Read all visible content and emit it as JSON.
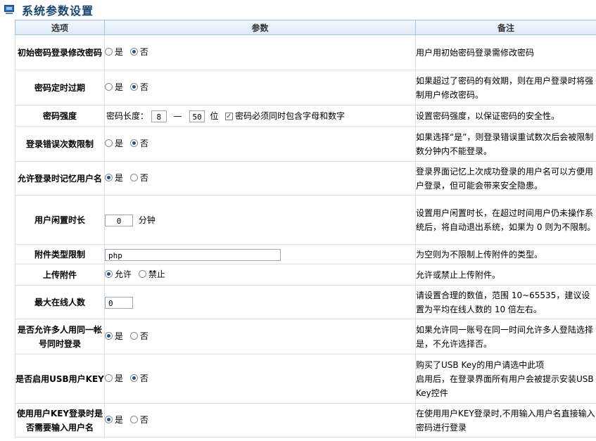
{
  "page": {
    "title": "系统参数设置",
    "icon": "monitor-icon"
  },
  "columns": {
    "option": "选项",
    "param": "参数",
    "note": "备注"
  },
  "rows": [
    {
      "label": "初始密码登录修改密码",
      "opt1": "是",
      "opt2": "否",
      "selected": 2,
      "note": "用户用初始密码登录需修改密码"
    },
    {
      "label": "密码定时过期",
      "opt1": "是",
      "opt2": "否",
      "selected": 2,
      "note": "如果超过了密码的有效期，则在用户登录时将强制用户修改密码。"
    },
    {
      "label": "密码强度",
      "prefix": "密码长度：",
      "min": "8",
      "dash": "—",
      "max": "50",
      "unit": "位",
      "checkbox": "密码必须同时包含字母和数字",
      "checked": true,
      "note": "设置密码强度，以保证密码的安全性。"
    },
    {
      "label": "登录错误次数限制",
      "opt1": "是",
      "opt2": "否",
      "selected": 2,
      "note": "如果选择“是”，则登录错误重试数次后会被限制数分钟内不能登录。"
    },
    {
      "label": "允许登录时记忆用户名",
      "opt1": "是",
      "opt2": "否",
      "selected": 1,
      "note": "登录界面记忆上次成功登录的用户名可以方便用户登录，但可能会带来安全隐患。"
    },
    {
      "label": "用户闲置时长",
      "value": "0",
      "unit": "分钟",
      "note": "设置用户闲置时长，在超过时间用户仍未操作系统后，将自动退出系统，如果为 0 则为不限制。"
    },
    {
      "label": "附件类型限制",
      "value": "php",
      "note": "为空则为不限制上传附件的类型。"
    },
    {
      "label": "上传附件",
      "opt1": "允许",
      "opt2": "禁止",
      "selected": 1,
      "note": "允许或禁止上传附件。"
    },
    {
      "label": "最大在线人数",
      "value": "0",
      "note": "请设置合理的数值，范围 10~65535，建议设置为平均在线人数的 10 倍左右。"
    },
    {
      "label": "是否允许多人用同一帐号同时登录",
      "opt1": "是",
      "opt2": "否",
      "selected": 1,
      "note": "如果允许同一账号在同一时间允许多人登陆选择是，不允许选择否。"
    },
    {
      "label": "是否启用USB用户KEY",
      "opt1": "是",
      "opt2": "否",
      "selected": 2,
      "note_line1": "购买了USB Key的用户请选中此项",
      "note_line2": "启用后，在登录界面所有用户会被提示安装USB Key控件"
    },
    {
      "label": "使用用户KEY登录时是否需要输入用户名",
      "opt1": "是",
      "opt2": "否",
      "selected": 1,
      "note": "在使用用户KEY登录时,不用输入用户名直接输入密码进行登录"
    }
  ]
}
